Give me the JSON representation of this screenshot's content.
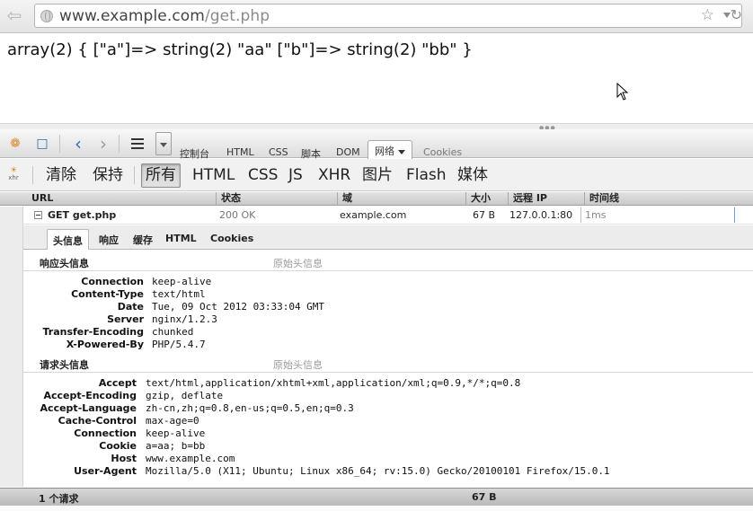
{
  "browser": {
    "url_host": "www.example.com",
    "url_path": "/get.php",
    "back_icon": "back-arrow-icon",
    "star_icon": "star-icon",
    "reload_icon": "reload-icon"
  },
  "page": {
    "output": "array(2) { [\"a\"]=> string(2) \"aa\" [\"b\"]=> string(2) \"bb\" }"
  },
  "firebug": {
    "panel_tabs": [
      "控制台",
      "HTML",
      "CSS",
      "脚本",
      "DOM",
      "网络",
      "Cookies"
    ],
    "active_panel_tab": "网络",
    "filters": [
      "清除",
      "保持",
      "所有",
      "HTML",
      "CSS",
      "JS",
      "XHR",
      "图片",
      "Flash",
      "媒体"
    ],
    "active_filter": "所有",
    "xhr_icon_label": "xhr",
    "columns": {
      "url": "URL",
      "status": "状态",
      "domain": "域",
      "size": "大小",
      "remote_ip": "远程 IP",
      "timeline": "时间线"
    },
    "request": {
      "name": "GET get.php",
      "status": "200 OK",
      "domain": "example.com",
      "size": "67 B",
      "remote_ip": "127.0.0.1:80",
      "time": "1ms"
    },
    "detail_tabs": [
      "头信息",
      "响应",
      "缓存",
      "HTML",
      "Cookies"
    ],
    "active_detail_tab": "头信息",
    "response_headers_title": "响应头信息",
    "request_headers_title": "请求头信息",
    "raw_headers_label": "原始头信息",
    "response_headers": [
      {
        "k": "Connection",
        "v": "keep-alive"
      },
      {
        "k": "Content-Type",
        "v": "text/html"
      },
      {
        "k": "Date",
        "v": "Tue, 09 Oct 2012 03:33:04 GMT"
      },
      {
        "k": "Server",
        "v": "nginx/1.2.3"
      },
      {
        "k": "Transfer-Encoding",
        "v": "chunked"
      },
      {
        "k": "X-Powered-By",
        "v": "PHP/5.4.7"
      }
    ],
    "request_headers": [
      {
        "k": "Accept",
        "v": "text/html,application/xhtml+xml,application/xml;q=0.9,*/*;q=0.8"
      },
      {
        "k": "Accept-Encoding",
        "v": "gzip, deflate"
      },
      {
        "k": "Accept-Language",
        "v": "zh-cn,zh;q=0.8,en-us;q=0.5,en;q=0.3"
      },
      {
        "k": "Cache-Control",
        "v": "max-age=0"
      },
      {
        "k": "Connection",
        "v": "keep-alive"
      },
      {
        "k": "Cookie",
        "v": "a=aa; b=bb"
      },
      {
        "k": "Host",
        "v": "www.example.com"
      },
      {
        "k": "User-Agent",
        "v": "Mozilla/5.0 (X11; Ubuntu; Linux x86_64; rv:15.0) Gecko/20100101 Firefox/15.0.1"
      }
    ],
    "summary": {
      "requests": "1 个请求",
      "total_size": "67 B"
    }
  }
}
